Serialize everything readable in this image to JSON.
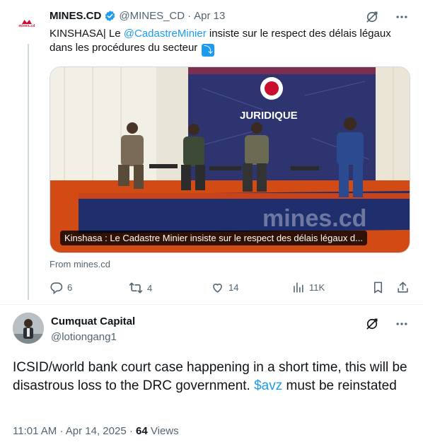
{
  "tweet": {
    "author_name": "MINES.CD",
    "author_handle": "@MINES_CD",
    "separator": "·",
    "date": "Apr 13",
    "avatar_logo_text": "mines.cd",
    "text_before_link": "KINSHASA| Le ",
    "mention": "@CadastreMinier",
    "text_after_link": " insiste sur le respect des délais légaux dans les procédures du secteur",
    "arrow_emoji": "⤵",
    "card": {
      "caption": "Kinshasa : Le Cadastre Minier insiste sur le respect des délais légaux d...",
      "banner_heading": "JURIDIQUE",
      "watermark": "mines.cd"
    },
    "from_text": "From mines.cd",
    "actions": {
      "replies": "6",
      "reposts": "4",
      "likes": "14",
      "views": "11K"
    }
  },
  "reply": {
    "author_name": "Cumquat Capital",
    "author_handle": "@lotiongang1",
    "text_before_cashtag": "ICSID/world bank court case happening in a short time, this will be disastrous loss to the DRC government. ",
    "cashtag": "$avz",
    "text_after_cashtag": " must be reinstated",
    "time": "11:01 AM",
    "separator": "·",
    "date": "Apr 14, 2025",
    "separator2": "·",
    "views_count": "64",
    "views_label": "Views"
  },
  "colors": {
    "accent": "#1d9bf0",
    "muted": "#536471",
    "text": "#0f1419",
    "verified": "#1d9bf0"
  },
  "icons": [
    "grok-icon",
    "more-icon",
    "reply-icon",
    "repost-icon",
    "like-icon",
    "views-icon",
    "bookmark-icon",
    "share-icon",
    "verified-icon"
  ]
}
